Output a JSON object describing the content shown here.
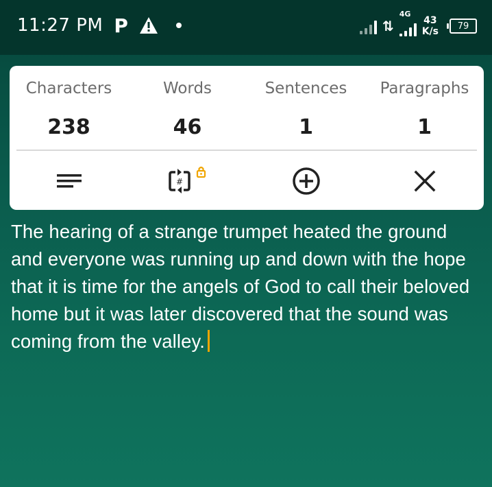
{
  "status_bar": {
    "time": "11:27 PM",
    "p_label": "P",
    "network_label": "4G",
    "speed_value": "43",
    "speed_unit": "K/s",
    "battery": "79"
  },
  "stats": [
    {
      "label": "Characters",
      "value": "238"
    },
    {
      "label": "Words",
      "value": "46"
    },
    {
      "label": "Sentences",
      "value": "1"
    },
    {
      "label": "Paragraphs",
      "value": "1"
    }
  ],
  "toolbar": {
    "icons": [
      "text-align-icon",
      "count-toggle-icon",
      "add-circle-icon",
      "close-icon"
    ],
    "lock_color": "#f0a500"
  },
  "editor": {
    "text": "The hearing of a strange trumpet heated the ground and everyone was running up and down with the hope that it is time for the angels of God to call their beloved home but it was later discovered that the sound was coming from the valley."
  },
  "colors": {
    "background": "#0a5a4c",
    "status_bar": "#04352c",
    "cursor": "#f0a500"
  }
}
